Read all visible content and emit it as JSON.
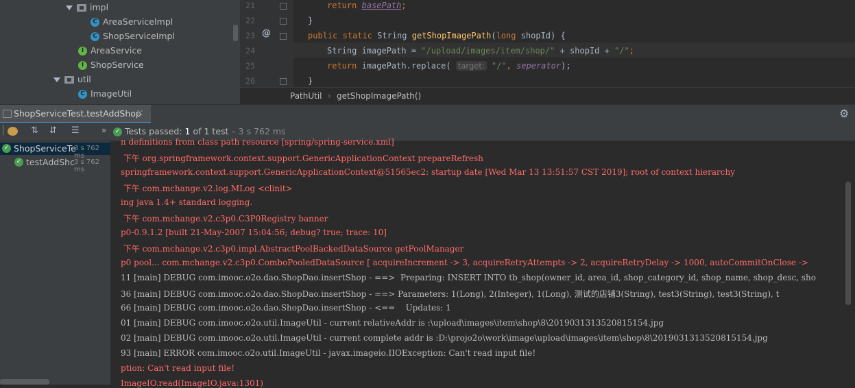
{
  "project_tree": {
    "items": [
      {
        "label": "impl",
        "kind": "folder",
        "expanded": true
      },
      {
        "label": "AreaServiceImpl",
        "kind": "class"
      },
      {
        "label": "ShopServiceImpl",
        "kind": "class"
      },
      {
        "label": "AreaService",
        "kind": "interface"
      },
      {
        "label": "ShopService",
        "kind": "interface"
      },
      {
        "label": "util",
        "kind": "folder",
        "expanded": true
      },
      {
        "label": "ImageUtil",
        "kind": "class"
      }
    ],
    "class_badge": "C",
    "interface_badge": "I"
  },
  "editor": {
    "line_numbers": [
      "21",
      "22",
      "23",
      "24",
      "25",
      "26"
    ],
    "lines": {
      "l21_kw": "return ",
      "l21_field": "basePath",
      "l21_end": ";",
      "l22": "}",
      "l23_kw": "public static ",
      "l23_type": "String ",
      "l23_fn": "getShopImagePath",
      "l23_open": "(",
      "l23_kw2": "long ",
      "l23_rest": "shopId) {",
      "l24_type": "String imagePath = ",
      "l24_str": "\"/upload/images/item/shop/\"",
      "l24_mid": " + shopId + ",
      "l24_str2": "\"/\"",
      "l24_end": ";",
      "l25_kw": "return ",
      "l25_call": "imagePath.replace( ",
      "l25_hint": "target:",
      "l25_str": " \"/\"",
      "l25_comma": ", ",
      "l25_field": "seperator",
      "l25_end": ");",
      "l26": "}"
    },
    "override_marker": "@",
    "breadcrumb": [
      "PathUtil",
      "getShopImagePath()"
    ]
  },
  "run_tab": {
    "title": "ShopServiceTest.testAddShop",
    "close": "×"
  },
  "toolbar": {
    "more": "»",
    "status_prefix": "Tests passed:",
    "status_count": "1",
    "status_suffix": "of 1 test",
    "status_time": "– 3 s 762 ms"
  },
  "test_tree": [
    {
      "label": "ShopServiceTe",
      "time": "3 s 762 ms"
    },
    {
      "label": "testAddShc",
      "time": "3 s 762 ms"
    }
  ],
  "console_lines": [
    {
      "text": "n definitions from class path resource [spring/spring-service.xml]",
      "level": "err"
    },
    {
      "text": " 下午 org.springframework.context.support.GenericApplicationContext prepareRefresh",
      "level": "err"
    },
    {
      "text": "springframework.context.support.GenericApplicationContext@51565ec2: startup date [Wed Mar 13 13:51:57 CST 2019]; root of context hierarchy",
      "level": "err"
    },
    {
      "text": " 下午 com.mchange.v2.log.MLog <clinit>",
      "level": "err"
    },
    {
      "text": "ing java 1.4+ standard logging.",
      "level": "err"
    },
    {
      "text": " 下午 com.mchange.v2.c3p0.C3P0Registry banner",
      "level": "err"
    },
    {
      "text": "p0-0.9.1.2 [built 21-May-2007 15:04:56; debug? true; trace: 10]",
      "level": "err"
    },
    {
      "text": " 下午 com.mchange.v2.c3p0.impl.AbstractPoolBackedDataSource getPoolManager",
      "level": "err"
    },
    {
      "text": "p0 pool... com.mchange.v2.c3p0.ComboPooledDataSource [ acquireIncrement -> 3, acquireRetryAttempts -> 2, acquireRetryDelay -> 1000, autoCommitOnClose ->",
      "level": "err"
    },
    {
      "text": "11 [main] DEBUG com.imooc.o2o.dao.ShopDao.insertShop - ==>  Preparing: INSERT INTO tb_shop(owner_id, area_id, shop_category_id, shop_name, shop_desc, sho",
      "level": "norm"
    },
    {
      "text": "36 [main] DEBUG com.imooc.o2o.dao.ShopDao.insertShop - ==> Parameters: 1(Long), 2(Integer), 1(Long), 测试的店铺3(String), test3(String), test3(String), t",
      "level": "norm"
    },
    {
      "text": "66 [main] DEBUG com.imooc.o2o.dao.ShopDao.insertShop - <==    Updates: 1",
      "level": "norm"
    },
    {
      "text": "01 [main] DEBUG com.imooc.o2o.util.ImageUtil - current relativeAddr is :\\upload\\images\\item\\shop\\8\\2019031313520815154.jpg",
      "level": "norm"
    },
    {
      "text": "02 [main] DEBUG com.imooc.o2o.util.ImageUtil - current complete addr is :D:\\projo2o\\work\\image\\upload\\images\\item\\shop\\8\\2019031313520815154.jpg",
      "level": "norm"
    },
    {
      "text": "93 [main] ERROR com.imooc.o2o.util.ImageUtil - javax.imageio.IIOException: Can't read input file!",
      "level": "norm"
    },
    {
      "text": "ption: Can't read input file!",
      "level": "err"
    },
    {
      "text": "ImageIO.read(ImageIO.java:1301)",
      "level": "err"
    }
  ],
  "colors": {
    "error": "#ff6b68",
    "normal": "#bbbbbb",
    "passed": "#499c54",
    "selection": "#0d293e"
  }
}
